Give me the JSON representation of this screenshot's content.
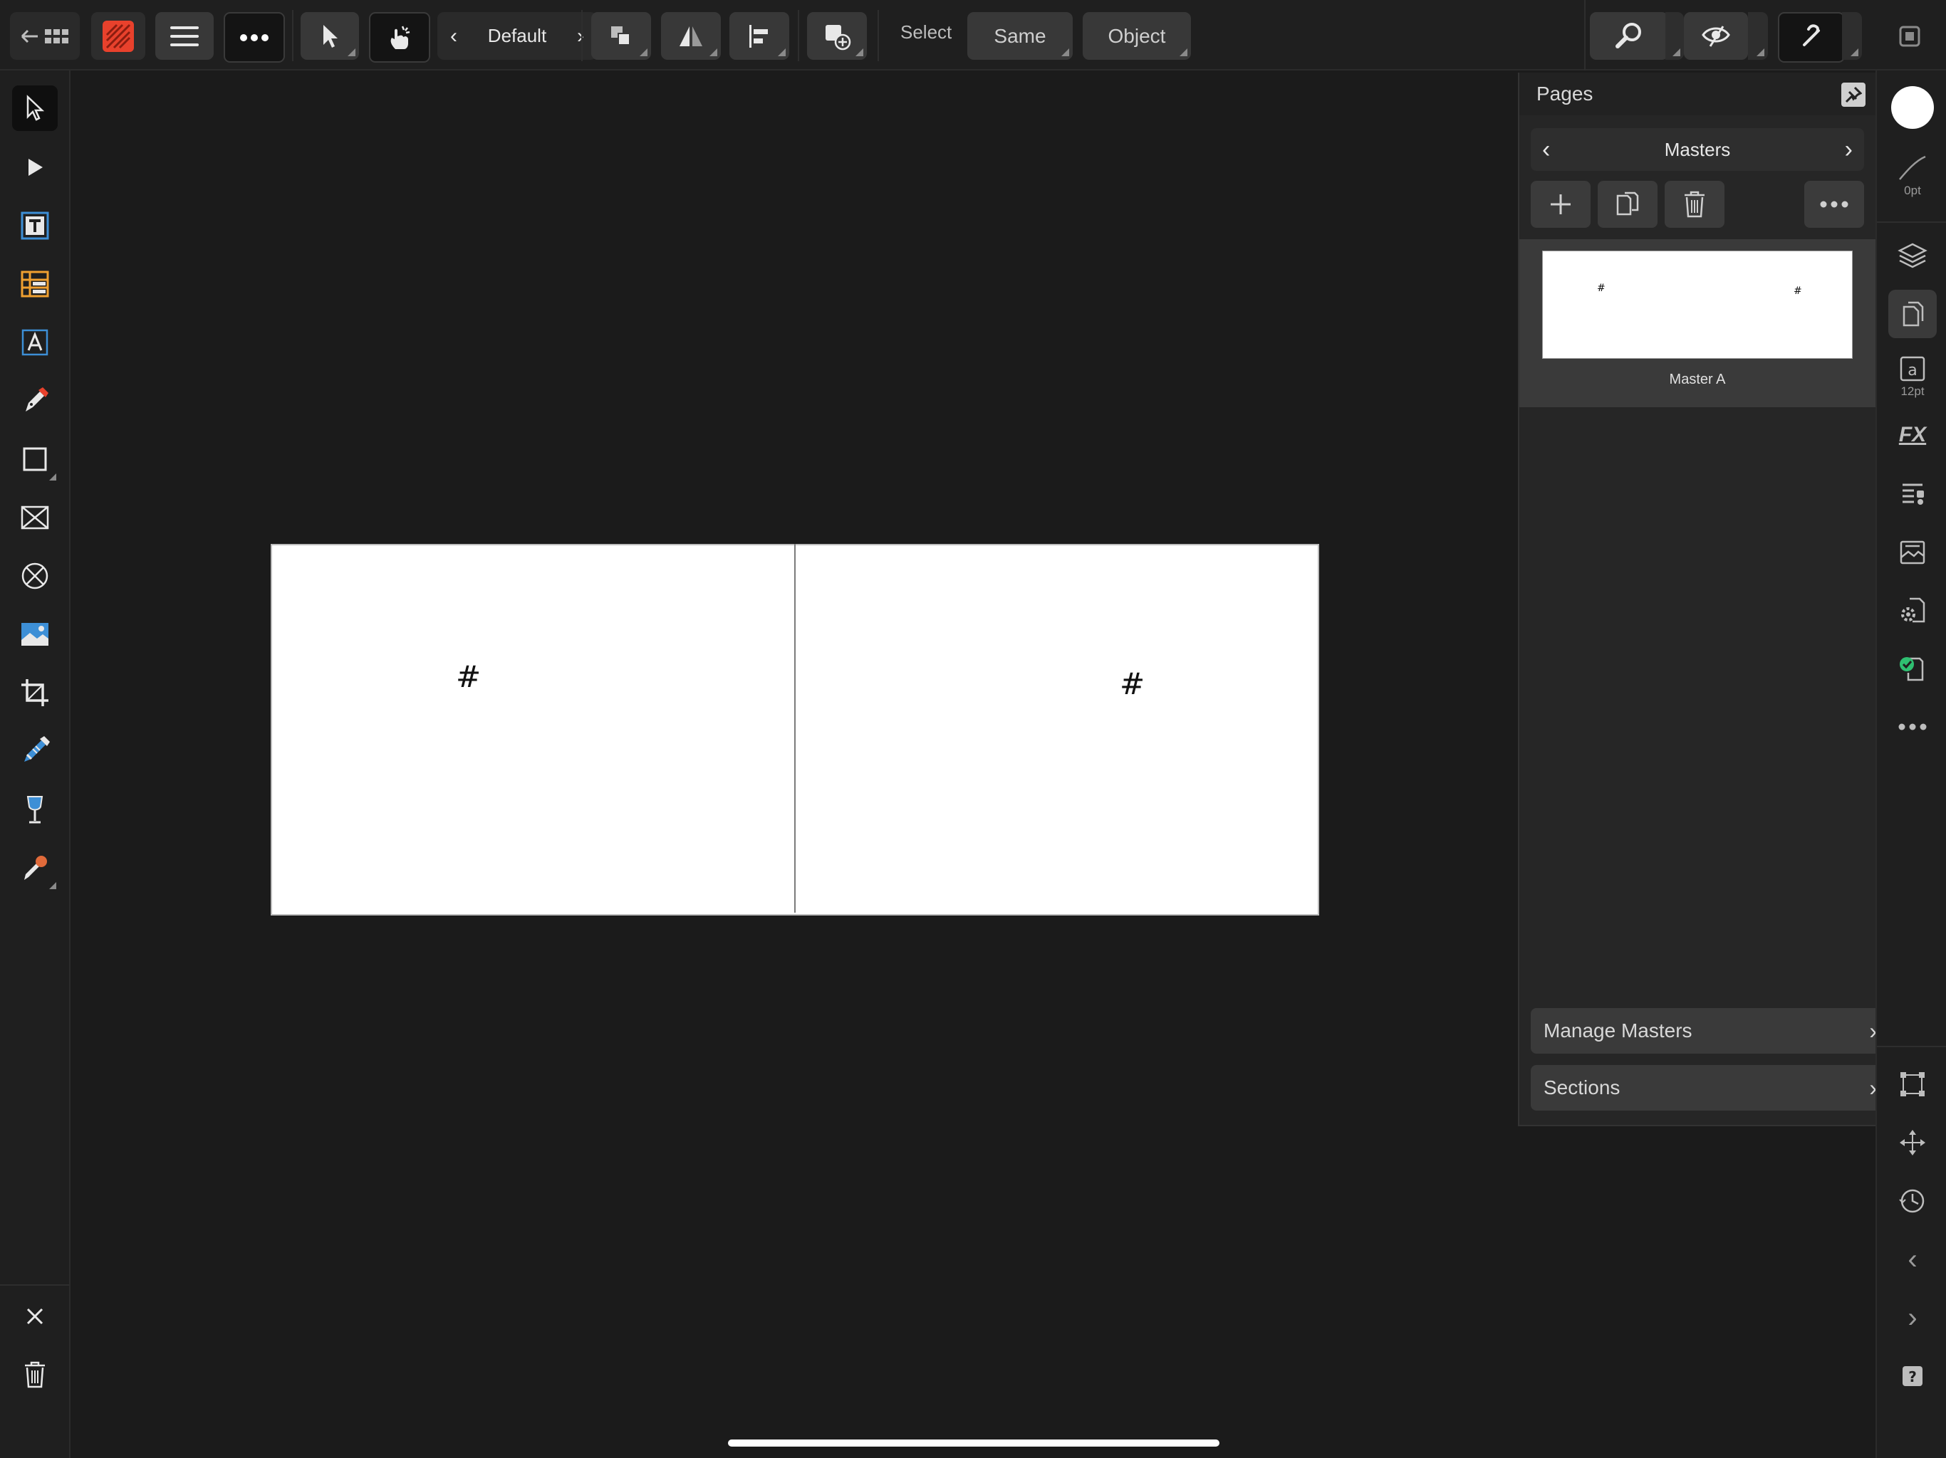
{
  "toolbar": {
    "view_preset": "Default",
    "select_label": "Select",
    "same_label": "Same",
    "object_label": "Object"
  },
  "pages_panel": {
    "title": "Pages",
    "section_label": "Masters",
    "master_thumbnail": {
      "label": "Master A",
      "left_marker": "#",
      "right_marker": "#"
    },
    "manage_masters_label": "Manage Masters",
    "sections_label": "Sections"
  },
  "canvas": {
    "left_page_text": "#",
    "right_page_text": "#"
  },
  "studio": {
    "stroke_width": "0pt",
    "text_size": "12pt",
    "fx_label": "FX"
  },
  "colors": {
    "accent_red": "#e8412c",
    "accent_blue": "#3d8fd6",
    "accent_orange": "#f0a030",
    "success_green": "#2fbf71"
  }
}
